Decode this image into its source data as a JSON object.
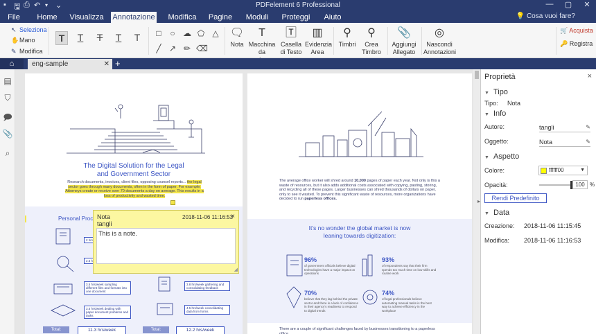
{
  "window": {
    "title": "PDFelement 6 Professional",
    "controls": [
      "—",
      "▢",
      "✕"
    ]
  },
  "menu": {
    "items": [
      "File",
      "Home",
      "Visualizza",
      "Annotazione",
      "Modifica",
      "Pagine",
      "Moduli",
      "Proteggi",
      "Aiuto"
    ],
    "active": "Annotazione",
    "ask": "Cosa vuoi fare?"
  },
  "ribbon": {
    "select_tools": [
      "Seleziona",
      "Mano",
      "Modifica"
    ],
    "buttons": [
      "Nota",
      "Macchina da scrivere",
      "Casella di Testo",
      "Evidenzia Area",
      "Timbri",
      "Crea Timbro",
      "Aggiungi Allegato",
      "Nascondi Annotazioni"
    ],
    "right": {
      "buy": "Acquista",
      "register": "Registra"
    }
  },
  "tabs": {
    "document": "eng-sample",
    "close": "✕",
    "add": "+"
  },
  "page1": {
    "title_line1": "The Digital Solution for the Legal",
    "title_line2": "and Government Sector",
    "body_plain": "Research documents, invoices, client files, opposing counsel reports...",
    "body_highlight": "the legal sector goes through many documents, often in the form of paper. For example: Attorneys create or receive over 70 documents a day on average. This results in a loss of productivity and wasted time.",
    "section_title": "Personal Proc",
    "labels": [
      "2 hrs/week ...",
      "2.5 hrs/week searching ...",
      "3.5 hrs/week sampling different files and formats into one document",
      "3.5 hrs/week dealing with paper document problems and tasks",
      "3.8 hrs/week gathering and consolidating feedback",
      "4.5 hrs/week consolidating data from forms"
    ],
    "total_label": "Total:",
    "totals": [
      "11.3 hrs/week",
      "12.2 hrs/week"
    ]
  },
  "page2": {
    "intro_plain": "The average office worker will shred around",
    "intro_bold": "10,000",
    "intro_rest": "pages of paper each year. Not only is this a waste of resources, but it also adds additional costs associated with copying, pasting, storing, and recycling all of these pages. Larger businesses can shred thousands of dollars on paper, only to see it wasted. To prevent this significant waste of resources, more organizations have decided to run",
    "intro_end": "paperless offices.",
    "heading_line1": "It's no wonder the global market is now",
    "heading_line2": "leaning towards digitization:",
    "stats": [
      {
        "value": "96%",
        "text": "of government officials believe digital technologies have a major impact on operations"
      },
      {
        "value": "93%",
        "text": "of respondents say that their firm spends too much time on low-skills and routine work"
      },
      {
        "value": "70%",
        "text": "believe that they lag behind the private sector and there is a lack of confidence in their agency's readiness to respond to digital trends"
      },
      {
        "value": "74%",
        "text": "of legal professionals believe automating manual tasks is the best way to achieve efficiency in the workplace"
      }
    ],
    "footer": "There are a couple of significant challenges faced by businesses transitioning to a paperless office."
  },
  "note": {
    "type": "Nota",
    "author": "tangli",
    "date": "2018-11-06 11:16:53",
    "close": "×",
    "content": "This is a note."
  },
  "properties": {
    "title": "Proprietà",
    "close": "×",
    "type_section": "Tipo",
    "type_label": "Tipo:",
    "type_value": "Nota",
    "info_section": "Info",
    "author_label": "Autore:",
    "author_value": "tangli",
    "subject_label": "Oggetto:",
    "subject_value": "Nota",
    "appearance_section": "Aspetto",
    "color_label": "Colore:",
    "color_value": "ffffff00",
    "color_hex": "#ffff00",
    "opacity_label": "Opacità:",
    "opacity_value": "100",
    "opacity_unit": "%",
    "reset_button": "Rendi Predefinito",
    "date_section": "Data",
    "created_label": "Creazione:",
    "created_value": "2018-11-06 11:15:45",
    "modified_label": "Modifica:",
    "modified_value": "2018-11-06 11:16:53"
  },
  "colors": {
    "brand": "#2a3c6f",
    "accent": "#3d56c4",
    "note_bg": "#fcf7a1",
    "highlight": "#f3e54a"
  }
}
